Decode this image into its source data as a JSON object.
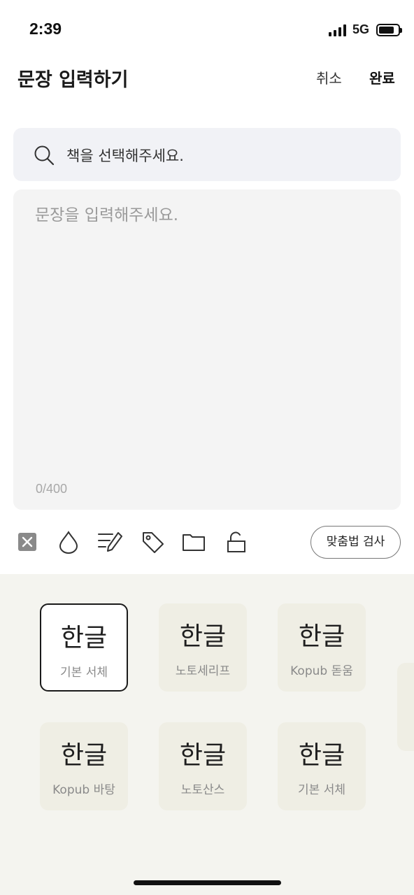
{
  "status_bar": {
    "time": "2:39",
    "network": "5G"
  },
  "header": {
    "title": "문장 입력하기",
    "cancel_label": "취소",
    "done_label": "완료"
  },
  "book_search": {
    "placeholder": "책을 선택해주세요.",
    "icon": "search-icon"
  },
  "sentence": {
    "placeholder": "문장을 입력해주세요.",
    "value": "",
    "char_count": "0/400"
  },
  "toolbar": {
    "icons": [
      "close-square-icon",
      "drop-icon",
      "edit-lines-icon",
      "tag-icon",
      "folder-icon",
      "unlock-icon"
    ],
    "spell_check_label": "맞춤법 검사"
  },
  "fonts": [
    {
      "sample": "한글",
      "name": "기본 서체",
      "selected": true
    },
    {
      "sample": "한글",
      "name": "노토세리프",
      "selected": false
    },
    {
      "sample": "한글",
      "name": "Kopub 돋움",
      "selected": false
    },
    {
      "sample": "한글",
      "name": "Kopub 바탕",
      "selected": false
    },
    {
      "sample": "한글",
      "name": "노토산스",
      "selected": false
    },
    {
      "sample": "한글",
      "name": "기본 서체",
      "selected": false
    }
  ],
  "colors": {
    "accent": "#1a1a1a",
    "panel_bg": "#f4f4ef",
    "card_bg": "#efeee4",
    "input_bg": "#f4f4f4",
    "search_bg": "#f1f2f6"
  }
}
